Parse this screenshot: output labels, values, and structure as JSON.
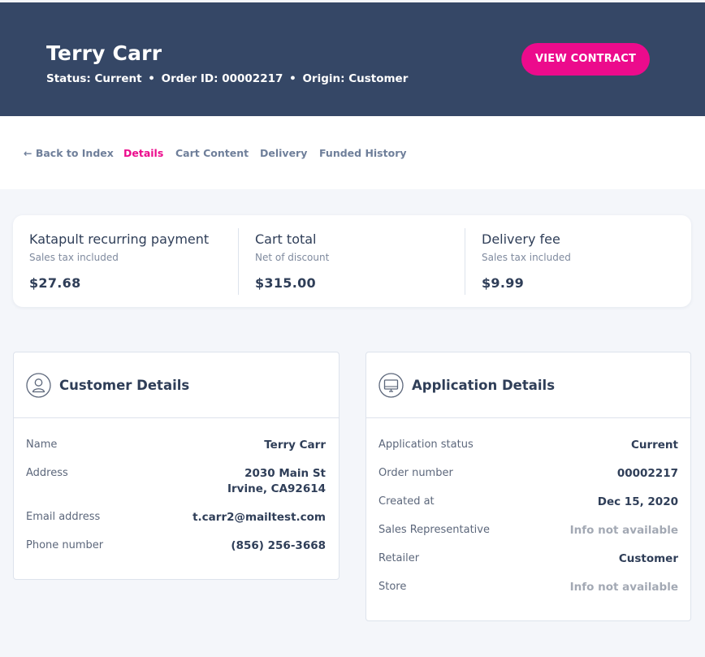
{
  "header": {
    "name": "Terry Carr",
    "status_line": {
      "status": "Status: Current",
      "order": "Order ID: 00002217",
      "origin": "Origin: Customer",
      "separator": "•"
    },
    "view_contract_label": "VIEW CONTRACT"
  },
  "nav": {
    "back_label": "← Back to Index",
    "tabs": [
      "Details",
      "Cart Content",
      "Delivery",
      "Funded History"
    ],
    "active_tab": "Details"
  },
  "summary": [
    {
      "title": "Katapult recurring payment",
      "subtitle": "Sales tax included",
      "value": "$27.68"
    },
    {
      "title": "Cart total",
      "subtitle": "Net of discount",
      "value": "$315.00"
    },
    {
      "title": "Delivery fee",
      "subtitle": "Sales tax included",
      "value": "$9.99"
    }
  ],
  "customer": {
    "title": "Customer Details",
    "icon": "user-icon",
    "rows": {
      "name": {
        "label": "Name",
        "value": "Terry Carr"
      },
      "address": {
        "label": "Address",
        "line1": "2030 Main St",
        "line2": "Irvine, CA92614"
      },
      "email": {
        "label": "Email address",
        "value": "t.carr2@mailtest.com"
      },
      "phone": {
        "label": "Phone number",
        "value": "(856) 256-3668"
      }
    }
  },
  "application": {
    "title": "Application Details",
    "icon": "monitor-icon",
    "rows": [
      {
        "label": "Application status",
        "value": "Current"
      },
      {
        "label": "Order number",
        "value": "00002217"
      },
      {
        "label": "Created at",
        "value": "Dec 15, 2020"
      },
      {
        "label": "Sales Representative",
        "value": "Info not available"
      },
      {
        "label": "Retailer",
        "value": "Customer"
      },
      {
        "label": "Store",
        "value": "Info not available"
      }
    ]
  },
  "colors": {
    "header_bg": "#354766",
    "accent": "#ec0b8c",
    "page_bg": "#f4f6fa",
    "text_dark": "#2f3e58",
    "muted": "#a3a9b4"
  }
}
